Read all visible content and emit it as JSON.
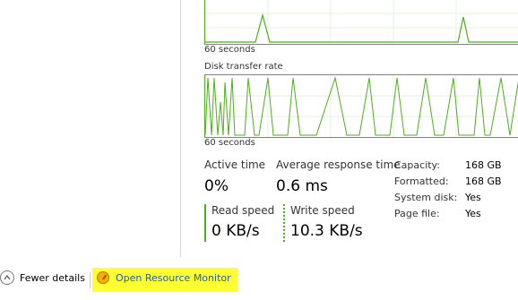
{
  "top_graph": {
    "time_label": "60 seconds"
  },
  "disk_graph": {
    "title": "Disk transfer rate",
    "time_label": "60 seconds"
  },
  "stats": {
    "active_time": {
      "label": "Active time",
      "value": "0%"
    },
    "avg_response": {
      "label": "Average response time",
      "value": "0.6 ms"
    },
    "read_speed": {
      "label": "Read speed",
      "value": "0 KB/s"
    },
    "write_speed": {
      "label": "Write speed",
      "value": "10.3 KB/s"
    }
  },
  "properties": [
    {
      "key": "Capacity:",
      "value": "168 GB"
    },
    {
      "key": "Formatted:",
      "value": "168 GB"
    },
    {
      "key": "System disk:",
      "value": "Yes"
    },
    {
      "key": "Page file:",
      "value": "Yes"
    }
  ],
  "footer": {
    "fewer_details": "Fewer details",
    "open_resource_monitor": "Open Resource Monitor"
  },
  "colors": {
    "graph_line": "#4caf1c",
    "link": "#1a5fb4",
    "highlight": "#ffff33"
  },
  "icons": {
    "fewer_details": "chevron-up-circle-icon",
    "resource_monitor": "resource-monitor-icon"
  }
}
